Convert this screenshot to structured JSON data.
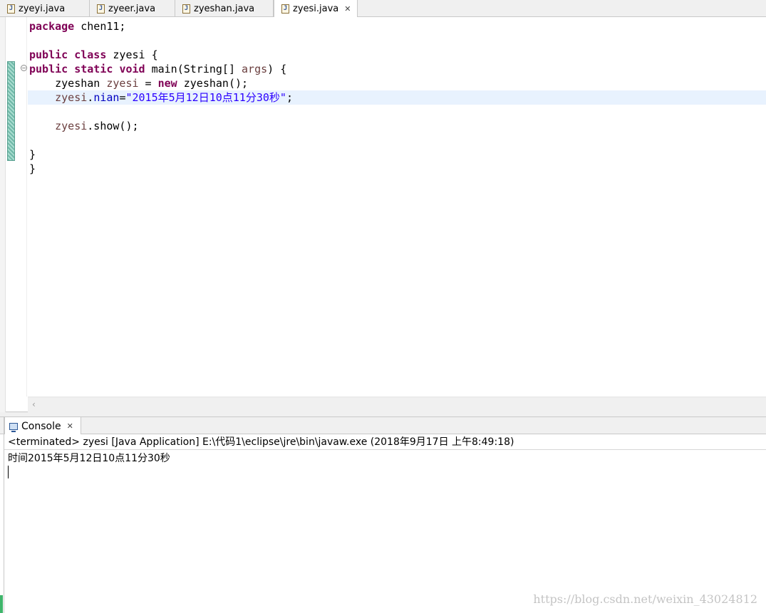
{
  "editor": {
    "tabs": [
      {
        "label": "zyeyi.java",
        "active": false
      },
      {
        "label": "zyeer.java",
        "active": false
      },
      {
        "label": "zyeshan.java",
        "active": false
      },
      {
        "label": "zyesi.java",
        "active": true
      }
    ],
    "close_glyph": "✕",
    "code": {
      "line1_kw": "package",
      "line1_rest": " chen11;",
      "line3_kw1": "public",
      "line3_kw2": "class",
      "line3_rest": " zyesi {",
      "line4_kw1": "public",
      "line4_kw2": "static",
      "line4_kw3": "void",
      "line4_mid": " main(String[] ",
      "line4_var": "args",
      "line4_end": ") {",
      "line5_indent": "    zyeshan ",
      "line5_var": "zyesi",
      "line5_mid": " = ",
      "line5_kw": "new",
      "line5_end": " zyeshan();",
      "line6_indent": "    ",
      "line6_var": "zyesi",
      "line6_dot": ".",
      "line6_field": "nian",
      "line6_eq": "=",
      "line6_str": "\"2015年5月12日10点11分30秒\"",
      "line6_end": ";",
      "line8_indent": "    ",
      "line8_var": "zyesi",
      "line8_end": ".show();",
      "line10": "}",
      "line11": "}"
    },
    "fold_glyph": "−",
    "hscroll_arrow": "‹"
  },
  "console": {
    "tab_label": "Console",
    "status": "<terminated> zyesi [Java Application] E:\\代码1\\eclipse\\jre\\bin\\javaw.exe (2018年9月17日 上午8:49:18)",
    "output": "时间2015年5月12日10点11分30秒"
  },
  "watermark": "https://blog.csdn.net/weixin_43024812",
  "colors": {
    "keyword": "#7f0055",
    "string": "#2a00ff",
    "field": "#0000c0",
    "current_line": "#e8f2fe"
  }
}
